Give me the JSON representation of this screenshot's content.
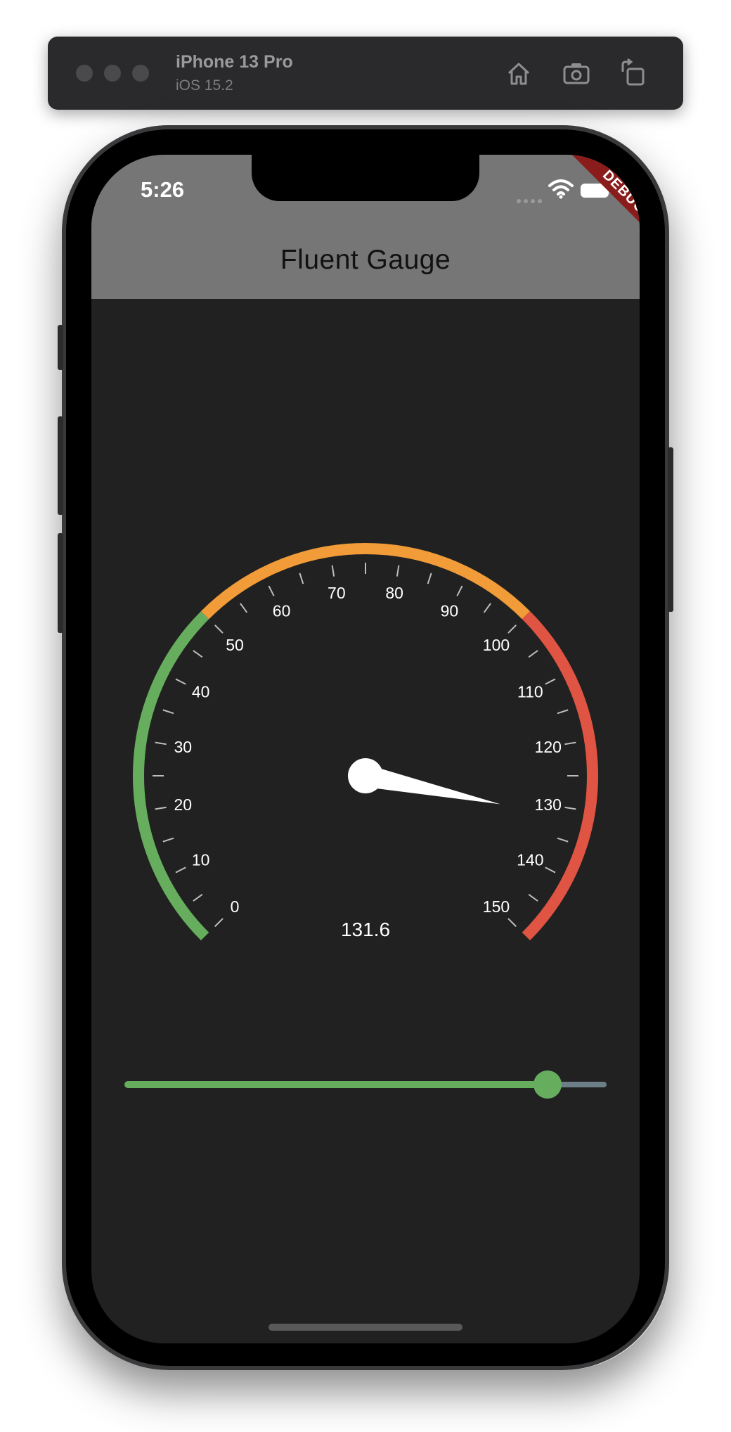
{
  "simulator": {
    "device_name": "iPhone 13 Pro",
    "os_version": "iOS 15.2",
    "icons": [
      "home-icon",
      "screenshot-icon",
      "rotate-icon"
    ]
  },
  "status_bar": {
    "time": "5:26",
    "icons": [
      "signal-icon",
      "wifi-icon",
      "battery-icon"
    ]
  },
  "debug_banner": "DEBUG",
  "app_bar": {
    "title": "Fluent Gauge"
  },
  "gauge": {
    "min": 0,
    "max": 150,
    "value": 131.6,
    "value_text": "131.6",
    "labels": [
      "0",
      "10",
      "20",
      "30",
      "40",
      "50",
      "60",
      "70",
      "80",
      "90",
      "100",
      "110",
      "120",
      "130",
      "140",
      "150"
    ],
    "ranges": [
      {
        "from": 0,
        "to": 50,
        "color": "#66ad5d"
      },
      {
        "from": 50,
        "to": 100,
        "color": "#f19c38"
      },
      {
        "from": 100,
        "to": 150,
        "color": "#e05444"
      }
    ],
    "needle_color": "#ffffff",
    "tick_color": "#bdbdbd"
  },
  "slider": {
    "value": 131.6,
    "min": 0,
    "max": 150,
    "active_color": "#66ad5d",
    "inactive_color": "#6c7f86"
  }
}
